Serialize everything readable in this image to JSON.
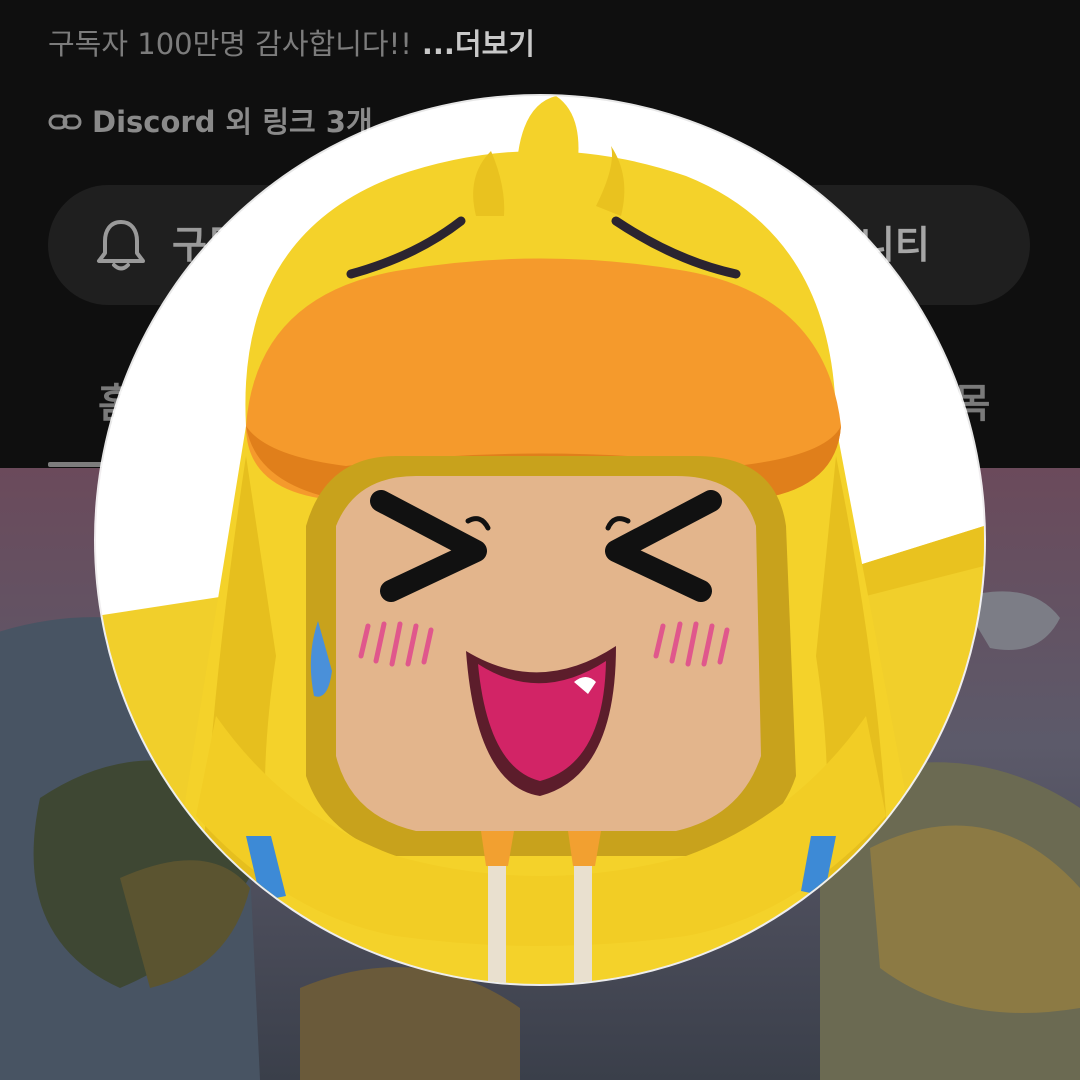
{
  "description": {
    "text": "구독자 100만명 감사합니다!!",
    "more_label": "...더보기"
  },
  "links": {
    "label": "Discord 외 링크 3개",
    "icon": "link-icon"
  },
  "actions": {
    "subscribe_label": "구독",
    "community_label": "커뮤니티",
    "bell_icon": "bell-icon"
  },
  "tabs": {
    "home": "홈",
    "playlist": "재생목"
  },
  "colors": {
    "background": "#0f0f0f",
    "pill": "#1f1f1f",
    "duck_yellow": "#f4d22a",
    "bill_orange": "#f59a2c",
    "face": "#e3b58c",
    "mouth": "#d22466"
  }
}
